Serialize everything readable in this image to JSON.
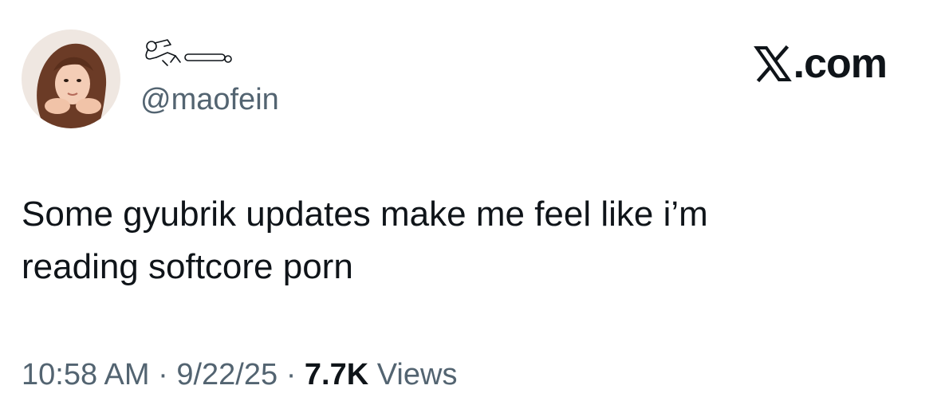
{
  "tweet": {
    "handle": "@maofein",
    "source_label": ".com",
    "source_icon": "x-logo-icon",
    "text": "Some gyubrik updates make me feel like i’m\nreading softcore porn",
    "time": "10:58 AM",
    "sep1": " · ",
    "date": "9/22/25",
    "sep2": " · ",
    "views_count": "7.7K",
    "views_label": " Views"
  },
  "colors": {
    "text": "#0f1419",
    "muted": "#536471"
  }
}
